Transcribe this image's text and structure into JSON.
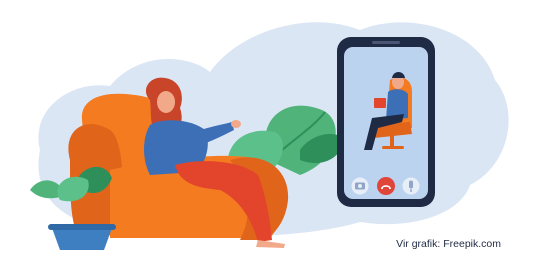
{
  "illustration": {
    "subject": "woman-in-armchair-video-call-with-therapist-on-phone",
    "colors": {
      "background_blob": "#dbe6f5",
      "armchair": "#f47b20",
      "armchair_shadow": "#e0641a",
      "woman_shirt": "#3d6fb6",
      "woman_pants": "#e2452b",
      "woman_hair": "#c8452a",
      "skin": "#f2a98a",
      "plant_leaf": "#4fb37a",
      "plant_leaf_dark": "#2f8f5b",
      "pot": "#3e7fc1",
      "phone_frame": "#1f2a44",
      "phone_screen": "#bcd3f0",
      "end_call_button": "#e0453a",
      "phone_button": "#ffffff"
    },
    "phone_icons": [
      "camera-icon",
      "end-call-icon",
      "microphone-icon"
    ]
  },
  "credit": {
    "text": "Vir grafik: Freepik.com"
  }
}
